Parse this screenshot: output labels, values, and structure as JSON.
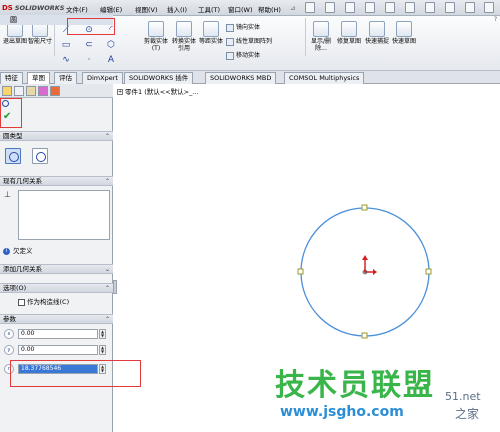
{
  "app": {
    "logo_text": "SOLIDWORKS",
    "logo_prefix": "DS"
  },
  "menu": {
    "items": [
      "文件(F)",
      "编辑(E)",
      "视图(V)",
      "插入(I)",
      "工具(T)",
      "窗口(W)",
      "帮助(H)"
    ],
    "pin": "⊿"
  },
  "ribbon": {
    "exit_sketch": "退出草图",
    "smart_dim": "智能尺寸",
    "trim": "剪裁实体(T)",
    "convert": "转换实体引用",
    "offset": "等距实体",
    "mirror": "镜向实体",
    "linear_pattern": "线性草图阵列",
    "move": "移动实体",
    "display_delete": "显示/删除...",
    "repair": "修复草图",
    "quick_snap": "快速捕捉",
    "quick_sketch": "快速草图"
  },
  "tabs": [
    "特征",
    "草图",
    "评估",
    "DimXpert",
    "SOLIDWORKS 插件",
    "SOLIDWORKS MBD",
    "COMSOL Multiphysics"
  ],
  "tree": {
    "label": "零件1 (默认<<默认>_..."
  },
  "pm": {
    "title": "圆",
    "help": "?",
    "sections": {
      "circle_type": "圆类型",
      "existing_relations": "现有几何关系",
      "add_relations": "添加几何关系",
      "options": "选项(O)",
      "parameters": "参数"
    },
    "status": "欠定义",
    "construction": "作为构造线(C)",
    "params": {
      "cx": "0.00",
      "cy": "0.00",
      "radius": "18.37768546"
    }
  },
  "watermark": {
    "main": "技术员联盟",
    "sub": "www.jsgho.com",
    "side": "51.net",
    "side2": "之家"
  },
  "colors": {
    "highlight": "#e23a3a",
    "circle": "#4a8fd8",
    "origin": "#d42020"
  }
}
